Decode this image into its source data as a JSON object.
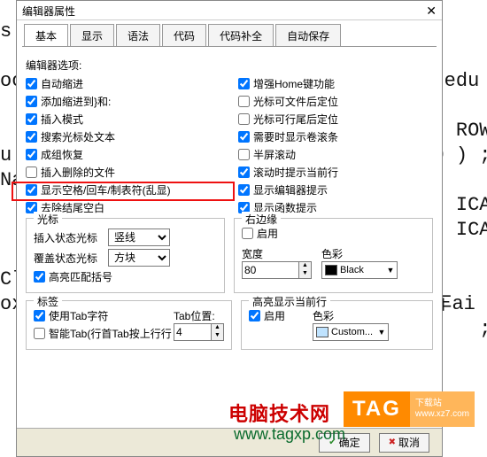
{
  "background_code": "s\n  ›\noc                                    edu\n\n                                       ROW\nu                                    0 ) ;¶\nNa\n  ›                                    ICA\n                                       ICA\n\nCl\nox                                   车ai\n  ›                                      ;¶",
  "dialog": {
    "title": "编辑器属性",
    "close": "✕",
    "tabs": [
      "基本",
      "显示",
      "语法",
      "代码",
      "代码补全",
      "自动保存"
    ],
    "active_tab": 0,
    "options_label": "编辑器选项:",
    "opts_left": [
      {
        "label": "自动缩进",
        "checked": true
      },
      {
        "label": "添加缩进到}和:",
        "checked": true
      },
      {
        "label": "插入模式",
        "checked": true
      },
      {
        "label": "搜索光标处文本",
        "checked": true
      },
      {
        "label": "成组恢复",
        "checked": true
      },
      {
        "label": "插入删除的文件",
        "checked": false
      },
      {
        "label": "显示空格/回车/制表符(乱显)",
        "checked": true
      },
      {
        "label": "去除结尾空白",
        "checked": true
      }
    ],
    "opts_right": [
      {
        "label": "增强Home键功能",
        "checked": true
      },
      {
        "label": "光标可文件后定位",
        "checked": false
      },
      {
        "label": "光标可行尾后定位",
        "checked": false
      },
      {
        "label": "需要时显示卷滚条",
        "checked": true
      },
      {
        "label": "半屏滚动",
        "checked": false
      },
      {
        "label": "滚动时提示当前行",
        "checked": true
      },
      {
        "label": "显示编辑器提示",
        "checked": true
      },
      {
        "label": "显示函数提示",
        "checked": true
      }
    ],
    "caret": {
      "legend": "光标",
      "insert_label": "插入状态光标",
      "insert_value": "竖线",
      "over_label": "覆盖状态光标",
      "over_value": "方块",
      "hilite": "高亮匹配括号",
      "hilite_checked": true
    },
    "rmargin": {
      "legend": "右边缘",
      "enable": "启用",
      "enable_checked": false,
      "width_label": "宽度",
      "width_value": "80",
      "color_label": "色彩",
      "color_name": "Black",
      "color_hex": "#000000"
    },
    "tabgrp": {
      "legend": "标签",
      "use_tab": "使用Tab字符",
      "use_tab_checked": true,
      "smart_tab": "智能Tab(行首Tab按上行行",
      "smart_tab_checked": false,
      "pos_label": "Tab位置:",
      "pos_value": "4"
    },
    "hl": {
      "legend": "高亮显示当前行",
      "enable": "启用",
      "enable_checked": true,
      "color_label": "色彩",
      "color_name": "Custom...",
      "color_hex": "#bfe3ff"
    },
    "buttons": {
      "ok": "确定",
      "cancel": "取消"
    }
  },
  "overlays": {
    "brand": "电脑技术网",
    "tag": "TAG",
    "tag_subA": "下载站",
    "tag_subB": "www.xz7.com",
    "link": "www.tagxp.com"
  }
}
